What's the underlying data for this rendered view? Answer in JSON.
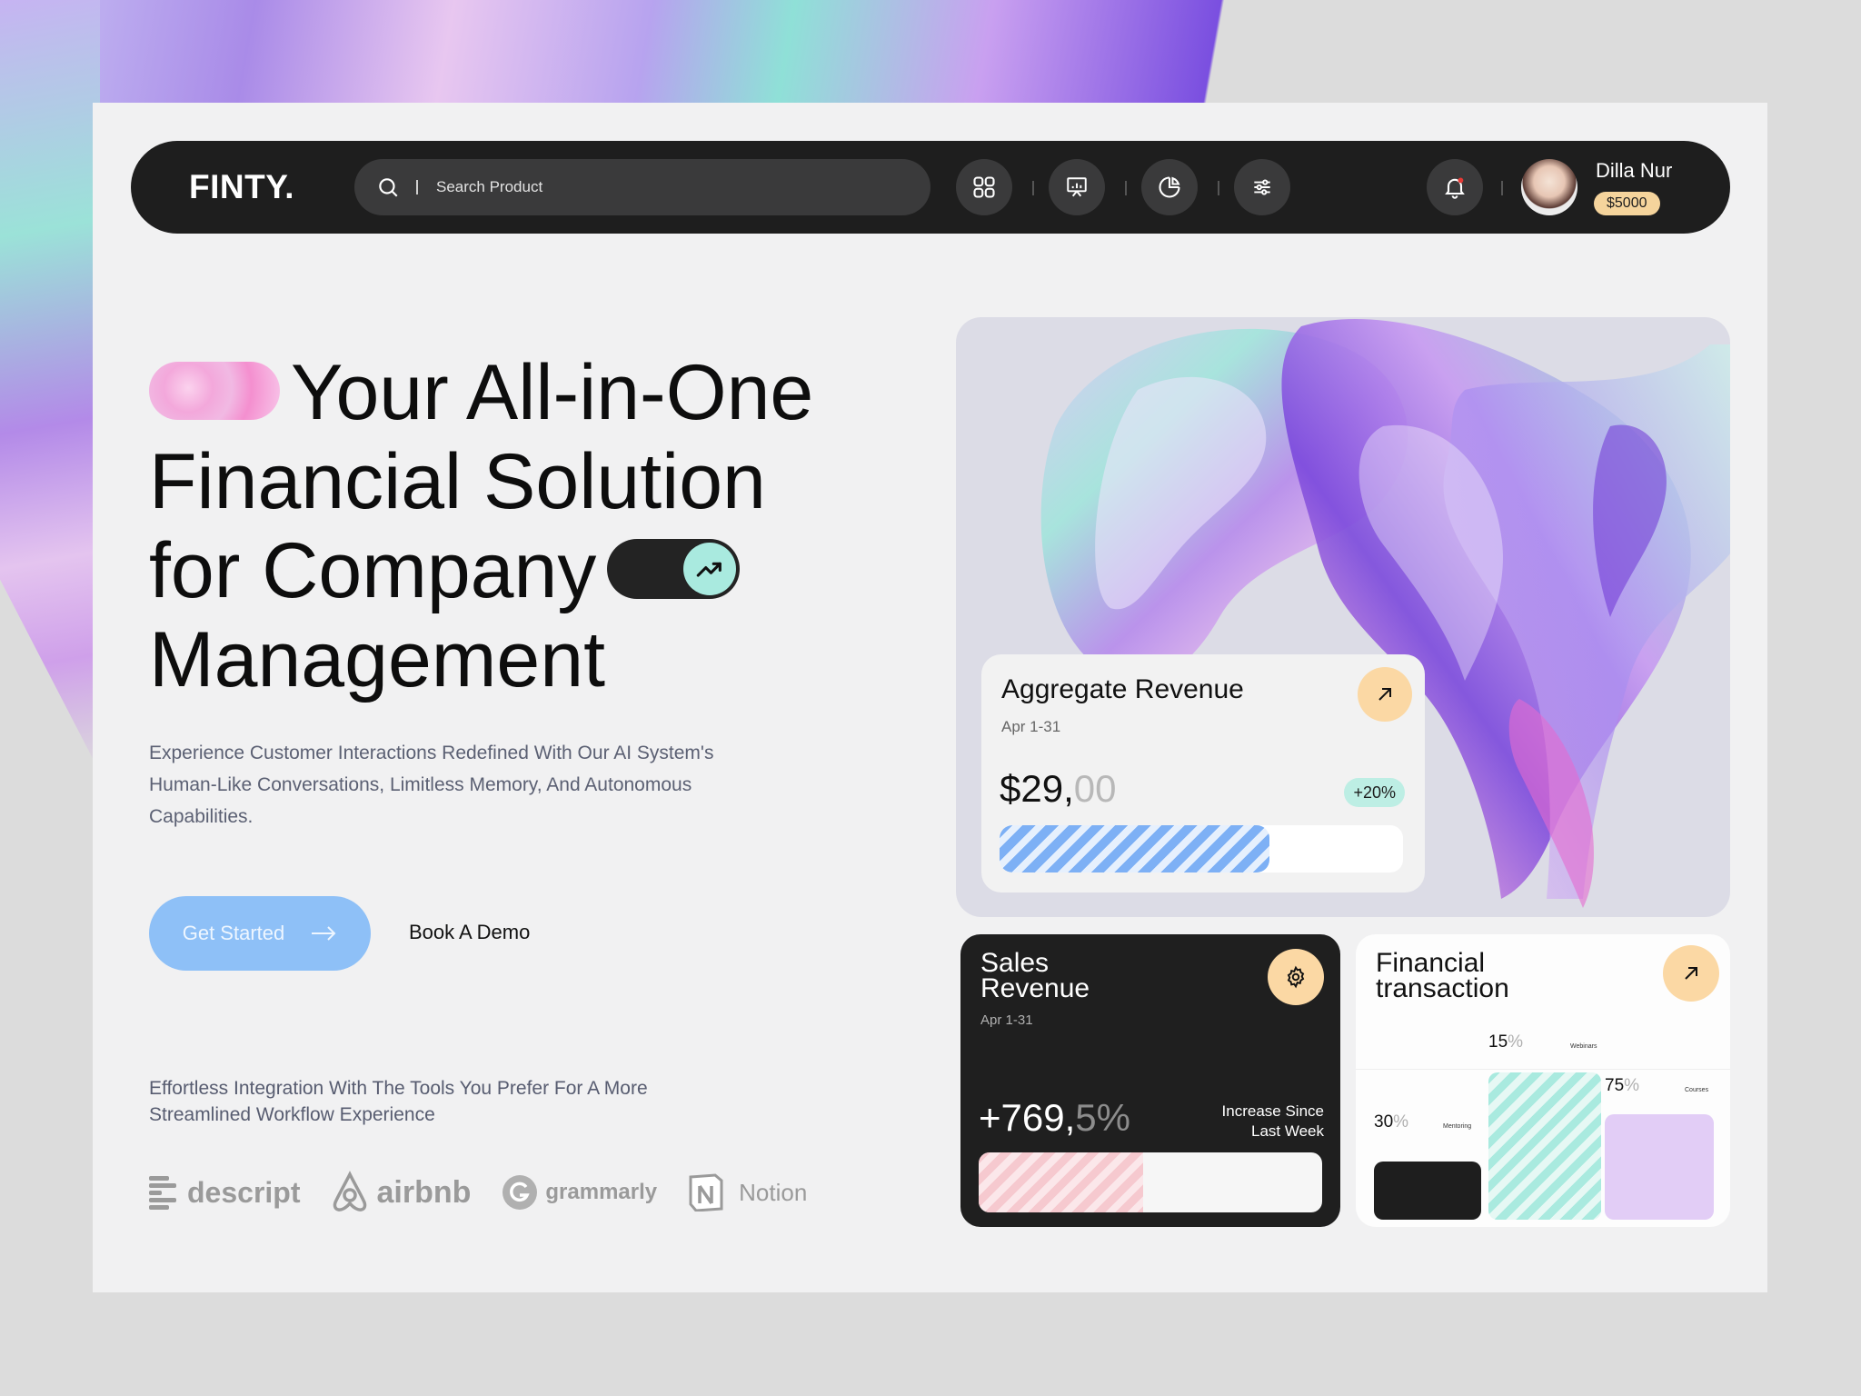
{
  "nav": {
    "logo": "FINTY.",
    "search_placeholder": "Search Product",
    "user_name": "Dilla Nur",
    "user_balance": "$5000"
  },
  "hero": {
    "title_line1": "Your All-in-One",
    "title_line2": "Financial Solution",
    "title_line3": "for Company",
    "title_line4": "Management",
    "description": "Experience Customer Interactions Redefined With Our AI System's Human-Like Conversations, Limitless Memory, And Autonomous Capabilities.",
    "primary_button": "Get Started",
    "secondary_button": "Book A Demo",
    "integration_text": "Effortless Integration With The Tools You Prefer For A More Streamlined Workflow Experience"
  },
  "brands": [
    "descript",
    "airbnb",
    "grammarly",
    "Notion"
  ],
  "aggregate_revenue": {
    "title": "Aggregate Revenue",
    "date": "Apr 1-31",
    "value_main": "$29,",
    "value_decimal": "00",
    "change": "+20%",
    "progress": 0.67
  },
  "sales_revenue": {
    "title_line1": "Sales",
    "title_line2": "Revenue",
    "date": "Apr 1-31",
    "value_main": "+769,",
    "value_decimal": "5%",
    "note_line1": "Increase Since",
    "note_line2": "Last Week",
    "progress": 0.48
  },
  "financial_transaction": {
    "title_line1": "Financial",
    "title_line2": "transaction",
    "items": [
      {
        "pct": "30",
        "label": "Mentoring",
        "color": "#1e1e1e"
      },
      {
        "pct": "15",
        "label": "Webinars",
        "color": "#a9eadf"
      },
      {
        "pct": "75",
        "label": "Courses",
        "color": "#e2cdf6"
      }
    ],
    "pct_sign": "%"
  },
  "colors": {
    "accent_blue": "#8ec0f7",
    "accent_peach": "#fbd8a4",
    "accent_mint": "#a9eadf",
    "dark": "#1e1e1e"
  }
}
